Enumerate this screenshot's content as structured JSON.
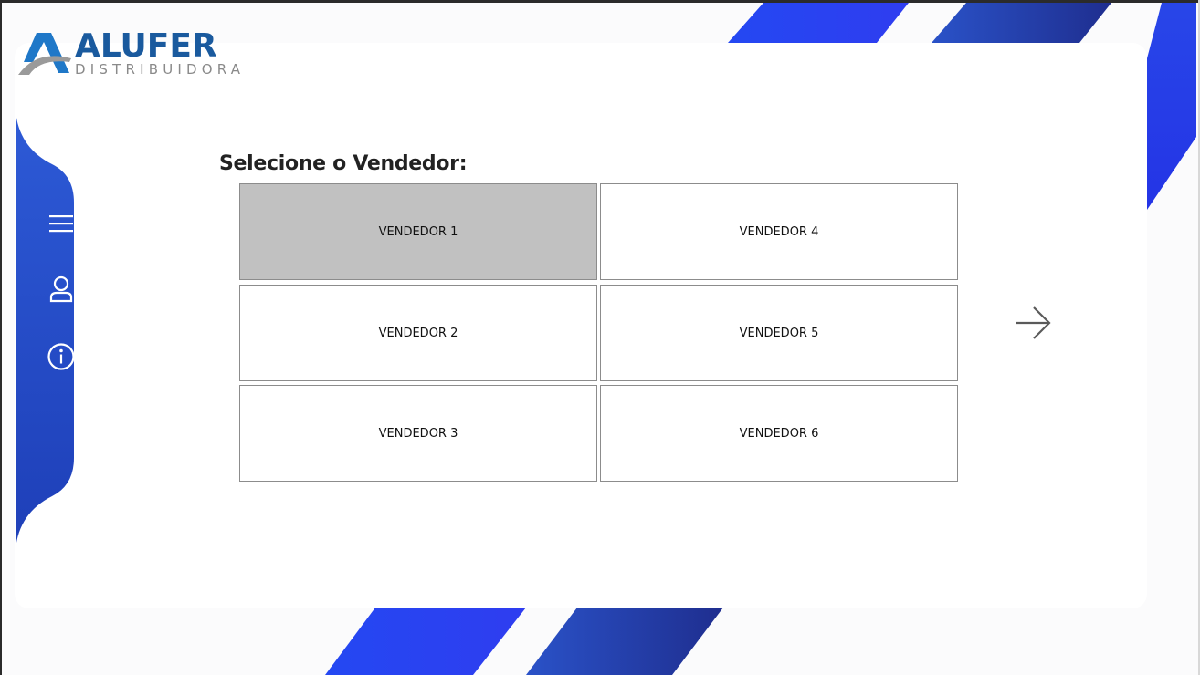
{
  "brand": {
    "name": "ALUFER",
    "tagline": "DISTRIBUIDORA",
    "colors": {
      "primary": "#1f3fd6",
      "logo_blue": "#1a5a9e",
      "logo_gray": "#8a8a8a"
    }
  },
  "sidebar": {
    "items": [
      {
        "icon": "menu-icon"
      },
      {
        "icon": "user-icon"
      },
      {
        "icon": "info-icon"
      }
    ]
  },
  "main": {
    "title": "Selecione o Vendedor:",
    "sellers": [
      {
        "label": "VENDEDOR 1",
        "selected": true
      },
      {
        "label": "VENDEDOR 2",
        "selected": false
      },
      {
        "label": "VENDEDOR 3",
        "selected": false
      },
      {
        "label": "VENDEDOR 4",
        "selected": false
      },
      {
        "label": "VENDEDOR 5",
        "selected": false
      },
      {
        "label": "VENDEDOR 6",
        "selected": false
      }
    ],
    "next_icon": "arrow-right-icon"
  }
}
